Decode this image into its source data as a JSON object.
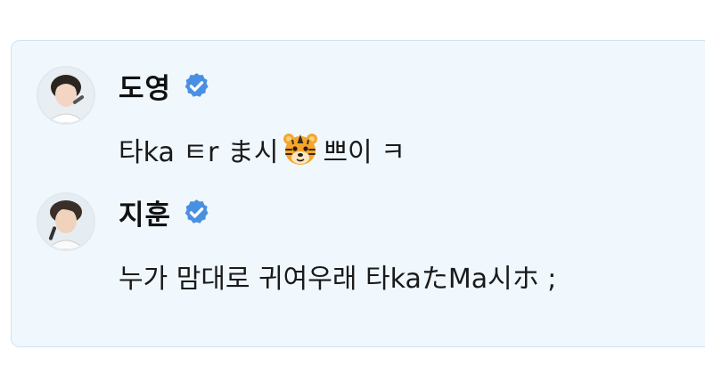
{
  "messages": [
    {
      "author": "도영",
      "avatar_icon": "avatar-doyoung",
      "verified_icon": "verified-badge-icon",
      "text_before_emoji": "타ka ㅌr ま시",
      "emoji": "tiger-face-emoji",
      "text_after_emoji": "쁘이 ㅋ"
    },
    {
      "author": "지훈",
      "avatar_icon": "avatar-jihoon",
      "verified_icon": "verified-badge-icon",
      "text": "누가 맘대로 귀여우래 타kaたMa시ホ ;"
    }
  ],
  "colors": {
    "card_background": "#f0f8fd",
    "card_border": "#cfe3f1",
    "verified_blue": "#4a90e2",
    "text": "#1a1a1a"
  }
}
